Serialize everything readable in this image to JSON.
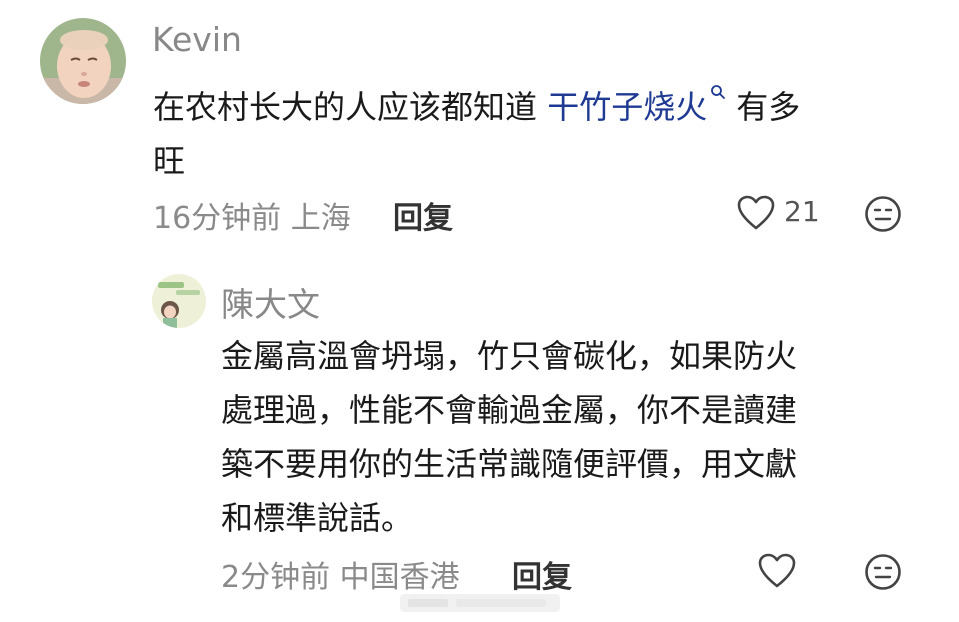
{
  "comments": [
    {
      "author": "Kevin",
      "text_before": "在农村长大的人应该都知道 ",
      "topic": "干竹子烧火",
      "text_after": "有多",
      "text_line2": "旺",
      "time": "16分钟前",
      "location": "上海",
      "reply_label": "回复",
      "likes": "21"
    },
    {
      "author": "陳大文",
      "lines": [
        "金屬高溫會坍塌，竹只會碳化，如果防火",
        "處理過，性能不會輸過金屬，你不是讀建",
        "築不要用你的生活常識隨便評價，用文獻",
        "和標準說話。"
      ],
      "time": "2分钟前",
      "location": "中国香港",
      "reply_label": "回复"
    }
  ],
  "icons": {
    "like": "heart-outline-icon",
    "react": "neutral-face-icon",
    "topic_search": "search-icon"
  },
  "colors": {
    "topic_link": "#1f3a93",
    "meta": "#8a8a8a",
    "icon": "#444444"
  }
}
